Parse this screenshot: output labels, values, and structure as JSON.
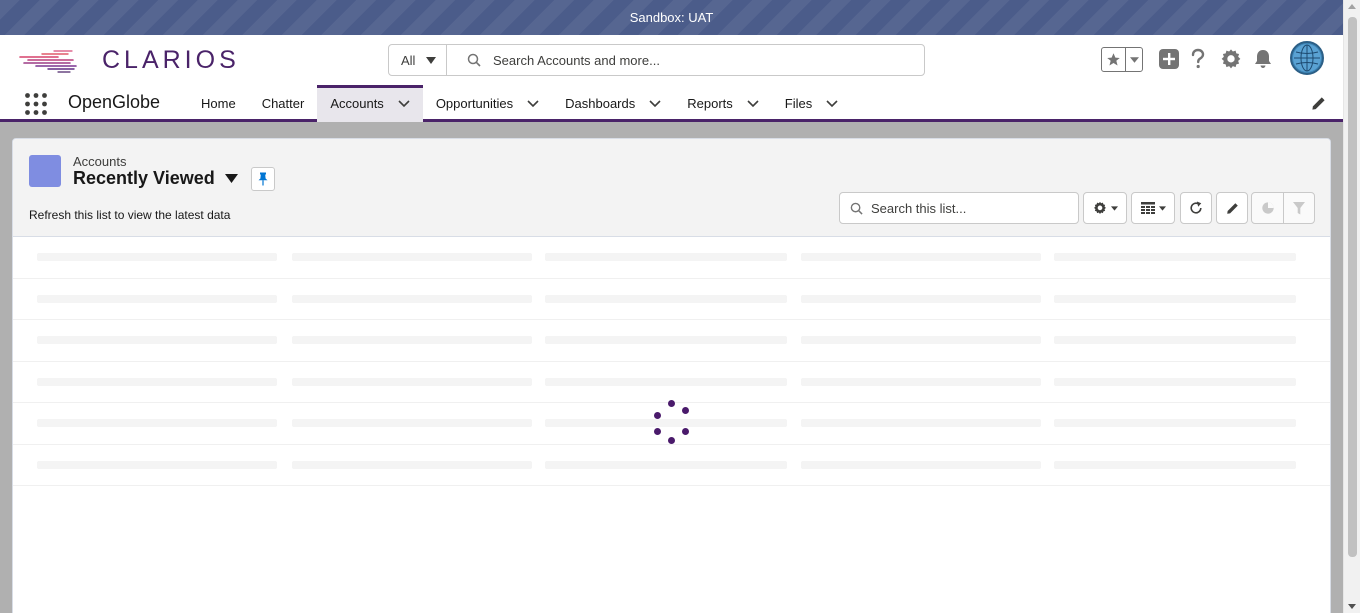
{
  "sandbox": {
    "label": "Sandbox: UAT"
  },
  "header": {
    "logo_text": "CLARIOS",
    "search": {
      "scope": "All",
      "placeholder": "Search Accounts and more..."
    },
    "icons": [
      "favorites-star-icon",
      "favorites-dropdown-icon",
      "global-create-icon",
      "help-icon",
      "setup-gear-icon",
      "notifications-bell-icon",
      "user-avatar"
    ]
  },
  "nav": {
    "app_name": "OpenGlobe",
    "items": [
      {
        "label": "Home",
        "has_menu": false
      },
      {
        "label": "Chatter",
        "has_menu": false
      },
      {
        "label": "Accounts",
        "has_menu": true,
        "active": true
      },
      {
        "label": "Opportunities",
        "has_menu": true
      },
      {
        "label": "Dashboards",
        "has_menu": true
      },
      {
        "label": "Reports",
        "has_menu": true
      },
      {
        "label": "Files",
        "has_menu": true
      }
    ]
  },
  "list_view": {
    "object_label": "Accounts",
    "title": "Recently Viewed",
    "refresh_message": "Refresh this list to view the latest data",
    "search_placeholder": "Search this list...",
    "object_icon_color": "#7f8de1"
  },
  "colors": {
    "brand": "#4a2369",
    "sandbox_bar": "#4b5c8a",
    "spinner": "#4a1a6b",
    "pin": "#0176d3"
  }
}
